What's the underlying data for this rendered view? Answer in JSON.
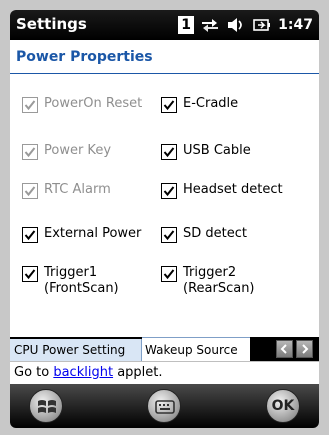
{
  "titlebar": {
    "app_title": "Settings",
    "notification_badge": "1",
    "clock": "1:47",
    "icons": [
      "sync-icon",
      "speaker-icon",
      "battery-charging-icon"
    ]
  },
  "page": {
    "title": "Power Properties"
  },
  "checkboxes": [
    {
      "label": "PowerOn Reset",
      "checked": true,
      "enabled": false
    },
    {
      "label": "E-Cradle",
      "checked": true,
      "enabled": true
    },
    {
      "label": "Power Key",
      "checked": true,
      "enabled": false
    },
    {
      "label": "USB Cable",
      "checked": true,
      "enabled": true
    },
    {
      "label": "RTC Alarm",
      "checked": true,
      "enabled": false
    },
    {
      "label": "Headset detect",
      "checked": true,
      "enabled": true
    },
    {
      "label": "External Power",
      "checked": true,
      "enabled": true
    },
    {
      "label": "SD detect",
      "checked": true,
      "enabled": true
    },
    {
      "label": "Trigger1\n(FrontScan)",
      "checked": true,
      "enabled": true
    },
    {
      "label": "Trigger2\n(RearScan)",
      "checked": true,
      "enabled": true
    }
  ],
  "tabs": [
    {
      "label": "CPU Power Setting",
      "selected": false
    },
    {
      "label": "Wakeup Source",
      "selected": true
    }
  ],
  "link_row": {
    "prefix": "Go to ",
    "link": "backlight",
    "suffix": " applet."
  },
  "softkeys": {
    "ok_label": "OK"
  },
  "colors": {
    "accent": "#1b57a7",
    "link": "#0000ee",
    "disabled_text": "#8f8f8f"
  }
}
